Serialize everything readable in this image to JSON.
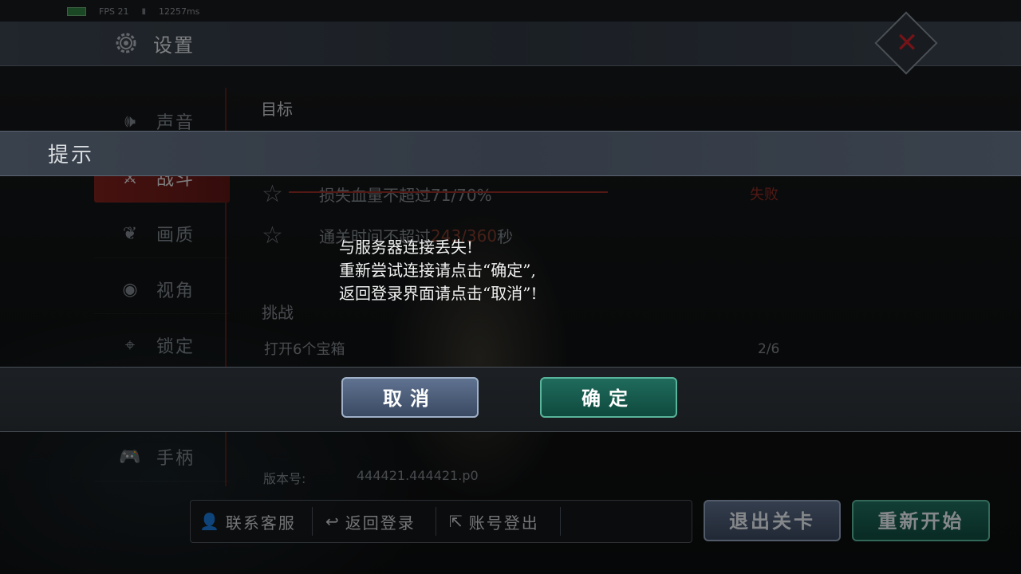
{
  "status": {
    "fps": "FPS 21",
    "ping": "12257ms"
  },
  "settings": {
    "title": "设置"
  },
  "sidebar": {
    "items": [
      {
        "icon": "speaker-icon",
        "label": "声音"
      },
      {
        "icon": "crossed-swords-icon",
        "label": "战斗"
      },
      {
        "icon": "palette-icon",
        "label": "画质"
      },
      {
        "icon": "eye-icon",
        "label": "视角"
      },
      {
        "icon": "crosshair-icon",
        "label": "锁定"
      },
      {
        "icon": "gamepad-icon",
        "label": "手柄"
      }
    ]
  },
  "content": {
    "objectives_heading": "目标",
    "objective1": "损失血量不超过71/70%",
    "objective1_status": "失败",
    "objective2_prefix": "通关时间不超过",
    "objective2_value": "243/360",
    "objective2_suffix": "秒",
    "challenge_heading": "挑战",
    "challenge1": "打开6个宝箱",
    "challenge1_progress": "2/6",
    "version_label": "版本号:",
    "version_value": "444421.444421.p0"
  },
  "dialog": {
    "title": "提示",
    "line1": "与服务器连接丢失!",
    "line2": "重新尝试连接请点击“确定”,",
    "line3": "返回登录界面请点击“取消”!",
    "cancel": "取消",
    "confirm": "确定"
  },
  "bottom": {
    "contact": "联系客服",
    "back_login": "返回登录",
    "logout": "账号登出",
    "exit_level": "退出关卡",
    "restart": "重新开始"
  }
}
